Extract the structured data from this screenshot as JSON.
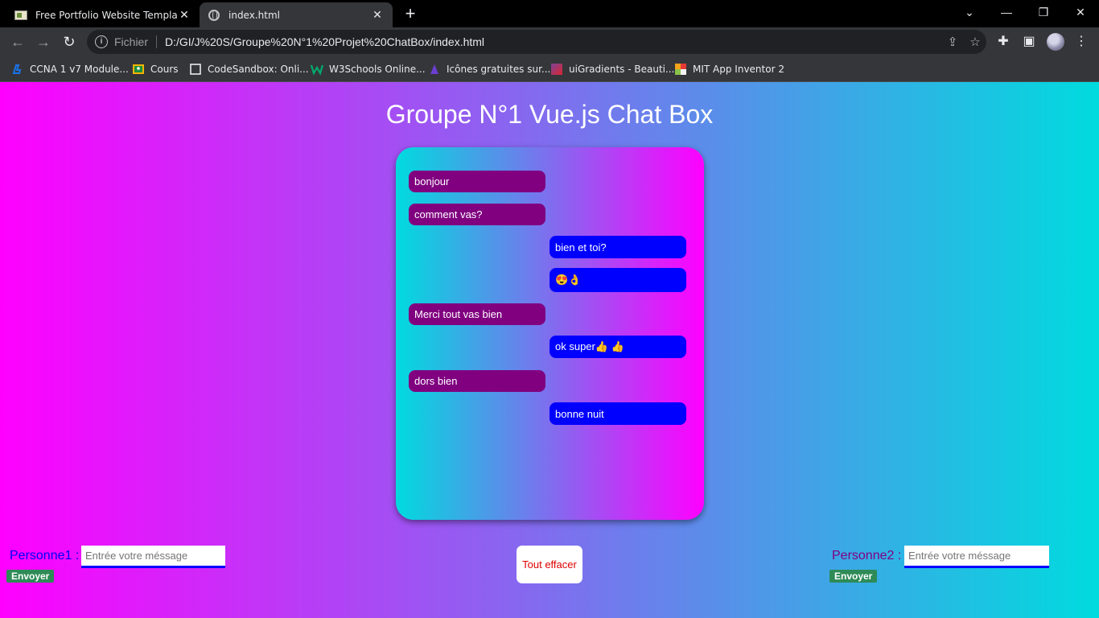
{
  "browser": {
    "tabs": [
      {
        "title": "Free Portfolio Website Templates"
      },
      {
        "title": "index.html"
      }
    ],
    "new_tab_symbol": "+",
    "window_controls": {
      "dropdown": "⌄",
      "minimize": "—",
      "restore": "❐",
      "close": "✕"
    },
    "address": {
      "security_label": "Fichier",
      "url": "D:/GI/J%20S/Groupe%20N°1%20Projet%20ChatBox/index.html"
    },
    "bookmarks": [
      {
        "label": "CCNA 1 v7 Module...",
        "icon": "ccna-icon",
        "color": "#1a73e8"
      },
      {
        "label": "Cours",
        "icon": "classroom-icon",
        "color": "#f4b400"
      },
      {
        "label": "CodeSandbox: Onli...",
        "icon": "codesandbox-icon",
        "color": "#e8eaed"
      },
      {
        "label": "W3Schools Online...",
        "icon": "w3schools-icon",
        "color": "#04aa6d"
      },
      {
        "label": "Icônes gratuites sur...",
        "icon": "icons-site-icon",
        "color": "#6a3fd1"
      },
      {
        "label": "uiGradients - Beauti...",
        "icon": "uigradients-icon",
        "color": "#c04dd0"
      },
      {
        "label": "MIT App Inventor 2",
        "icon": "app-inventor-icon",
        "color": "#f7a21b"
      }
    ]
  },
  "page": {
    "title": "Groupe N°1 Vue.js Chat Box",
    "colors": {
      "gradient_start": "#ff00ff",
      "gradient_end": "#00dbde",
      "person1_bubble": "#800080",
      "person2_bubble": "#0000ff",
      "send_button": "#2e8b57"
    },
    "messages": [
      {
        "sender": "Personne1",
        "text": "bonjour"
      },
      {
        "sender": "Personne1",
        "text": "comment vas?"
      },
      {
        "sender": "Personne2",
        "text": "bien et toi?"
      },
      {
        "sender": "Personne2",
        "text": "😍👌"
      },
      {
        "sender": "Personne1",
        "text": "Merci tout vas bien"
      },
      {
        "sender": "Personne2",
        "text": "ok super👍 👍"
      },
      {
        "sender": "Personne1",
        "text": "dors bien"
      },
      {
        "sender": "Personne2",
        "text": "bonne nuit"
      }
    ],
    "person1": {
      "label": "Personne1 :",
      "placeholder": "Entrée votre méssage",
      "value": "",
      "send_label": "Envoyer"
    },
    "person2": {
      "label": "Personne2 :",
      "placeholder": "Entrée votre méssage",
      "value": "",
      "send_label": "Envoyer"
    },
    "clear_label": "Tout effacer"
  }
}
